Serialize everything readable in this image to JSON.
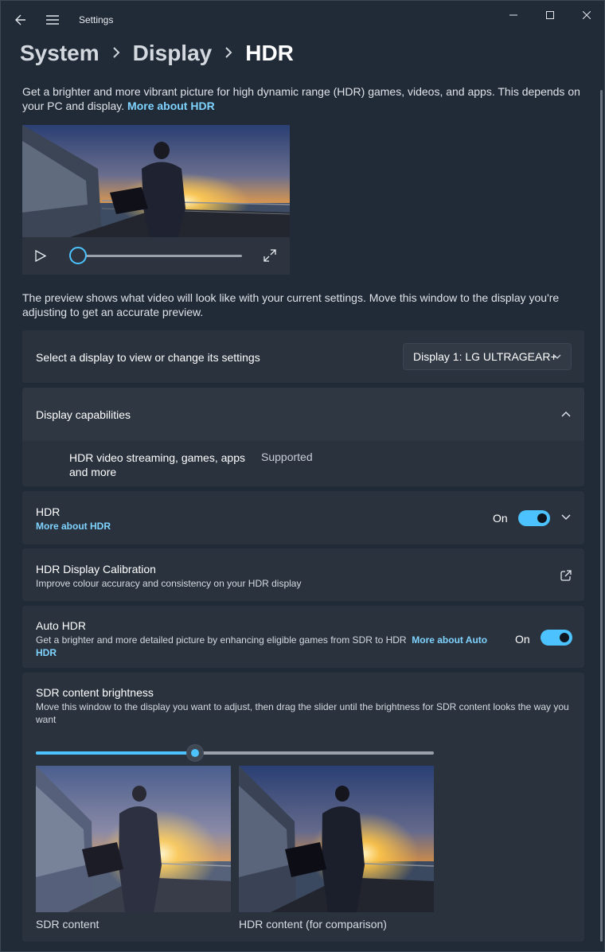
{
  "window": {
    "app_title": "Settings",
    "icons": {
      "back": "back-arrow-icon",
      "menu": "hamburger-menu-icon",
      "minimize": "minimize-icon",
      "maximize": "maximize-icon",
      "close": "close-icon"
    }
  },
  "breadcrumb": {
    "items": [
      "System",
      "Display",
      "HDR"
    ]
  },
  "intro": {
    "text": "Get a brighter and more vibrant picture for high dynamic range (HDR) games, videos, and apps. This depends on your PC and display. ",
    "link": "More about HDR"
  },
  "video_preview": {
    "progress": 0
  },
  "preview_note": "The preview shows what video will look like with your current settings. Move this window to the display you're adjusting to get an accurate preview.",
  "display_select": {
    "label": "Select a display to view or change its settings",
    "selected": "Display 1: LG ULTRAGEAR+"
  },
  "capabilities": {
    "title": "Display capabilities",
    "feature": "HDR video streaming, games, apps and more",
    "status": "Supported"
  },
  "hdr": {
    "title": "HDR",
    "link": "More about HDR",
    "state_label": "On",
    "enabled": true
  },
  "calibration": {
    "title": "HDR Display Calibration",
    "subtitle": "Improve colour accuracy and consistency on your HDR display"
  },
  "auto_hdr": {
    "title": "Auto HDR",
    "subtitle": "Get a brighter and more detailed picture by enhancing eligible games from SDR to HDR",
    "link": "More about Auto HDR",
    "state_label": "On",
    "enabled": true
  },
  "sdr_brightness": {
    "title": "SDR content brightness",
    "subtitle": "Move this window to the display you want to adjust, then drag the slider until the brightness for SDR content looks the way you want",
    "value_fraction": 0.4,
    "sdr_label": "SDR content",
    "hdr_label": "HDR content (for comparison)"
  },
  "colors": {
    "accent": "#4cc2ff",
    "link": "#7fd3ff",
    "background": "#202a37",
    "card": "#2a323e"
  }
}
